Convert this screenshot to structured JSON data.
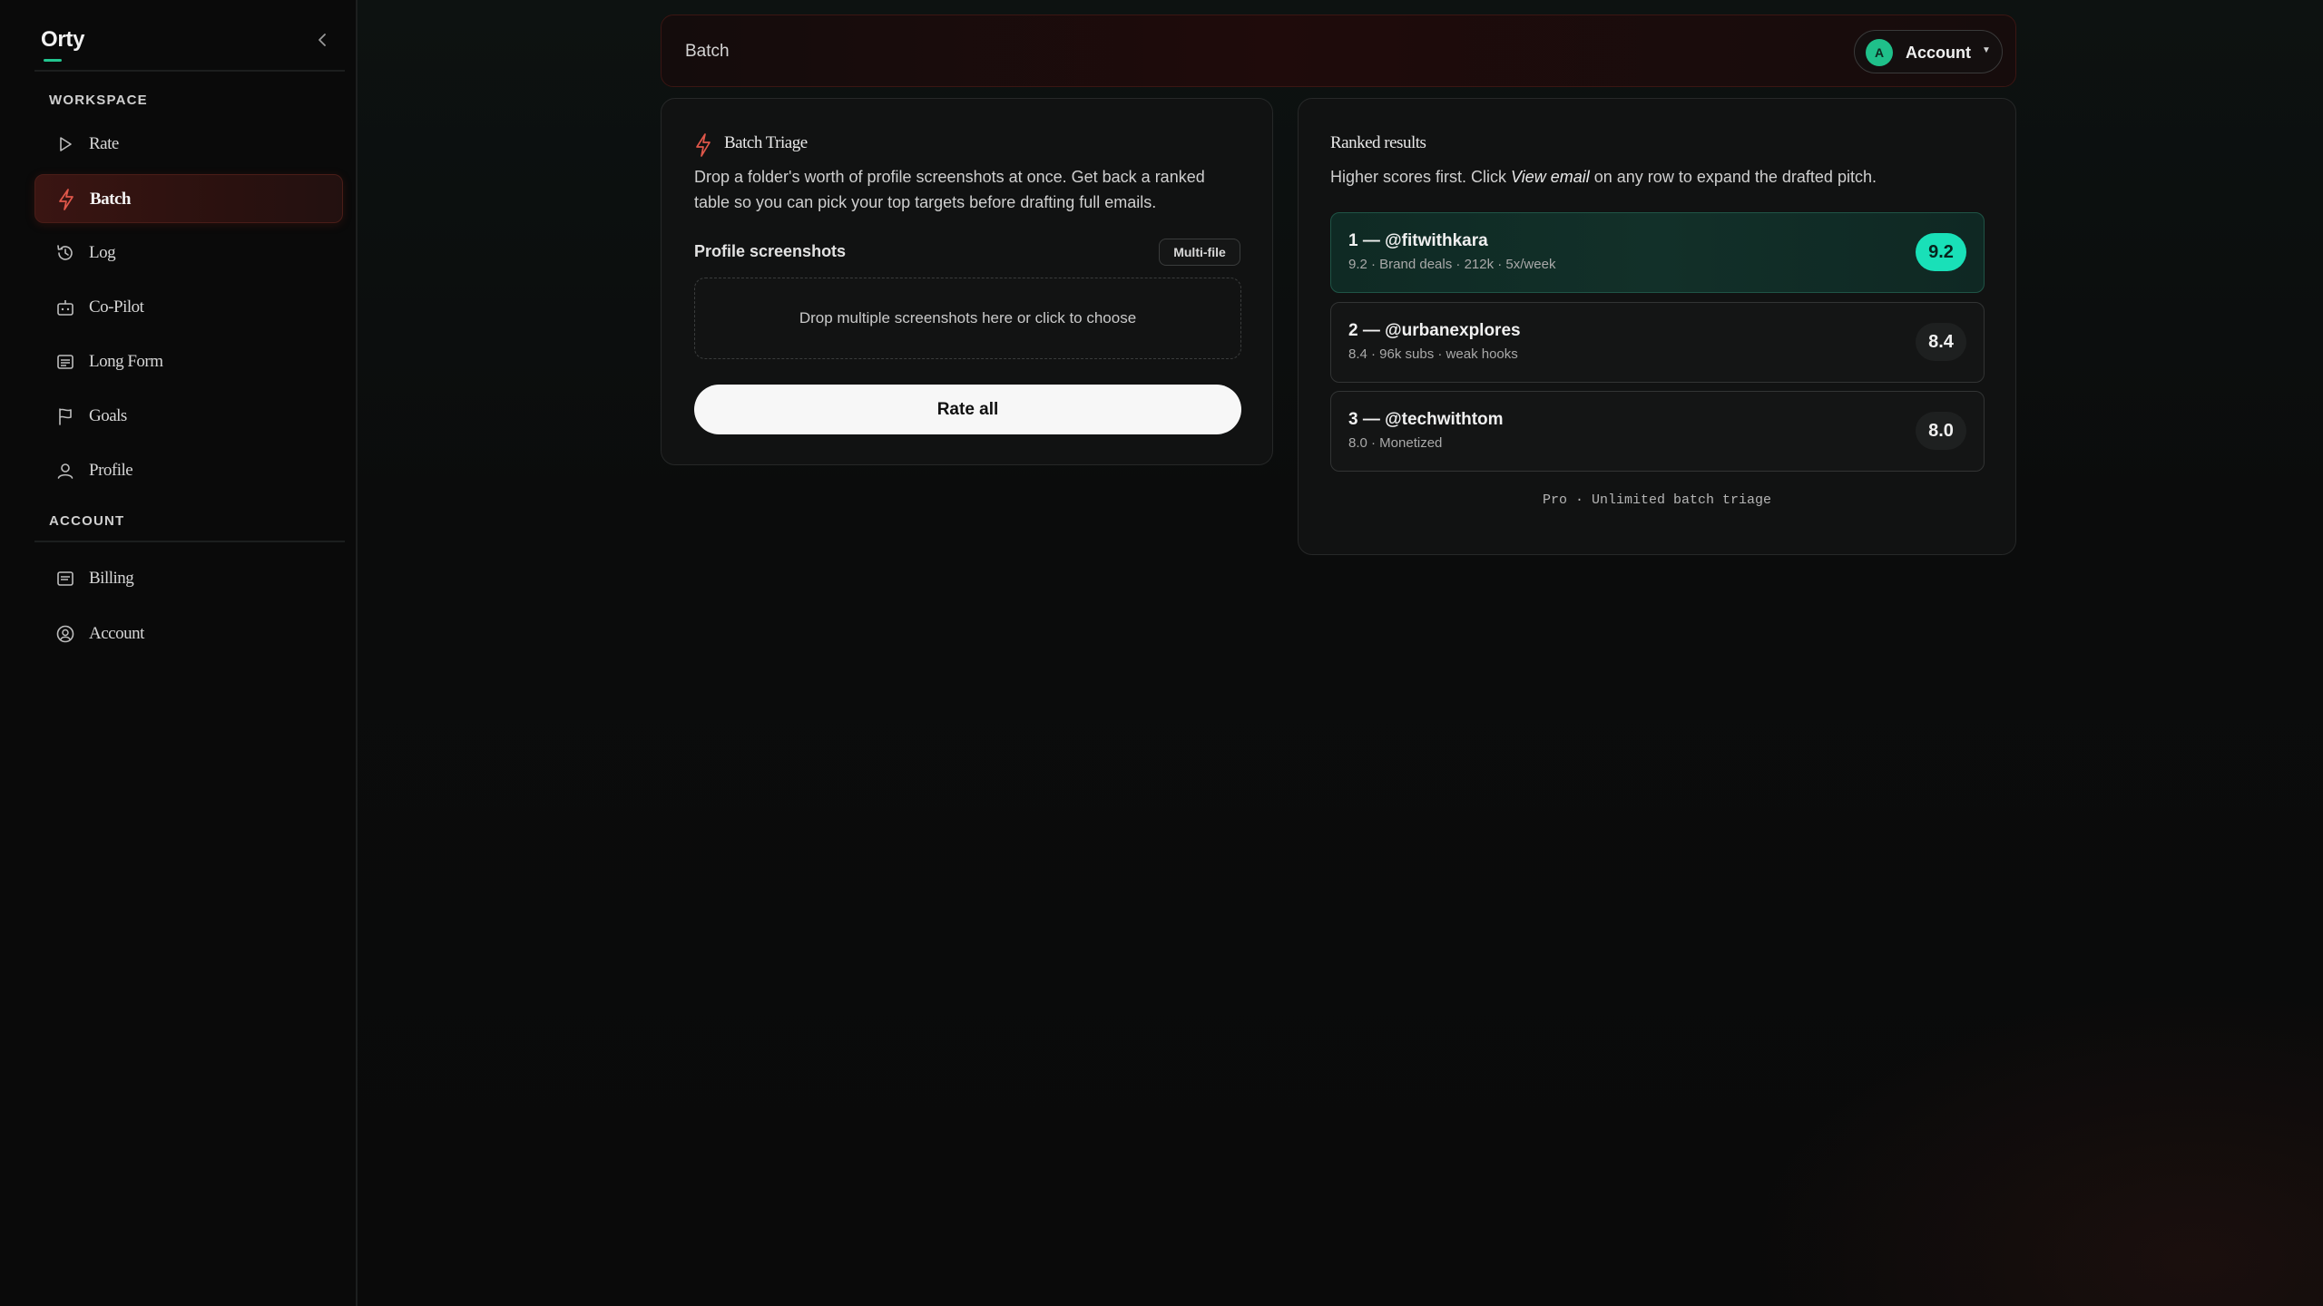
{
  "app": {
    "name": "Orty"
  },
  "sidebar": {
    "workspace_label": "WORKSPACE",
    "account_label": "ACCOUNT",
    "workspace_items": [
      {
        "label": "Rate",
        "icon": "play-icon"
      },
      {
        "label": "Batch",
        "icon": "bolt-icon",
        "active": true
      },
      {
        "label": "Log",
        "icon": "history-icon"
      },
      {
        "label": "Co-Pilot",
        "icon": "robot-icon"
      },
      {
        "label": "Long Form",
        "icon": "document-icon"
      },
      {
        "label": "Goals",
        "icon": "flag-icon"
      },
      {
        "label": "Profile",
        "icon": "user-icon"
      }
    ],
    "account_items": [
      {
        "label": "Billing",
        "icon": "receipt-icon"
      },
      {
        "label": "Account",
        "icon": "user-circle-icon"
      }
    ]
  },
  "header": {
    "title": "Batch",
    "account_button": "Account",
    "avatar_initial": "A"
  },
  "batch_card": {
    "title": "Batch Triage",
    "description": "Drop a folder's worth of profile screenshots at once. Get back a ranked table so you can pick your top targets before drafting full emails.",
    "field_label": "Profile screenshots",
    "badge": "Multi-file",
    "dropzone_text": "Drop multiple screenshots here or click to choose",
    "button": "Rate all"
  },
  "results_card": {
    "title": "Ranked results",
    "desc_before": "Higher scores first. Click ",
    "desc_emphasis": "View email",
    "desc_after": " on any row to expand the drafted pitch.",
    "rows": [
      {
        "title": "1 — @fitwithkara",
        "subtitle": "9.2 · Brand deals · 212k · 5x/week",
        "score": "9.2"
      },
      {
        "title": "2 — @urbanexplores",
        "subtitle": "8.4 · 96k subs · weak hooks",
        "score": "8.4"
      },
      {
        "title": "3 — @techwithtom",
        "subtitle": "8.0 · Monetized",
        "score": "8.0"
      }
    ],
    "footer": "Pro · Unlimited batch triage"
  },
  "colors": {
    "accent_green": "#19e0b8",
    "brand_green": "#22c58f",
    "active_red": "#3a1512",
    "bolt_red": "#e0574a"
  }
}
